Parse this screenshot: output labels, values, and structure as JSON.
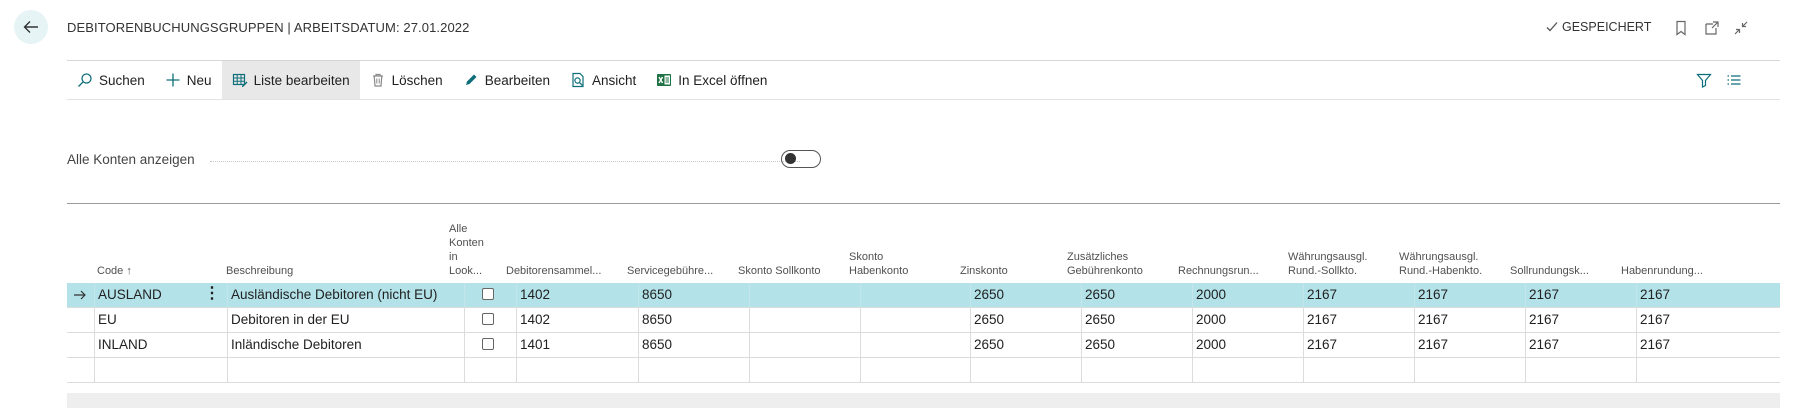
{
  "header": {
    "title": "DEBITORENBUCHUNGSGRUPPEN | ARBEITSDATUM: 27.01.2022",
    "status": "GESPEICHERT"
  },
  "actions": [
    {
      "label": "Suchen",
      "icon": "search-icon"
    },
    {
      "label": "Neu",
      "icon": "plus-icon"
    },
    {
      "label": "Liste bearbeiten",
      "icon": "edit-list-icon"
    },
    {
      "label": "Löschen",
      "icon": "trash-icon"
    },
    {
      "label": "Bearbeiten",
      "icon": "pencil-icon"
    },
    {
      "label": "Ansicht",
      "icon": "view-icon"
    },
    {
      "label": "In Excel öffnen",
      "icon": "excel-icon"
    }
  ],
  "filter": {
    "label": "Alle Konten anzeigen",
    "value": false
  },
  "table": {
    "headers": {
      "code": "Code ↑",
      "beschreibung": "Beschreibung",
      "alle_konten": "Alle Konten in Look...",
      "debitoren": "Debitorensammel...",
      "service": "Servicegebühre...",
      "skonto_soll": "Skonto Sollkonto",
      "skonto_haben": "Skonto Habenkonto",
      "zins": "Zinskonto",
      "zusatz": "Zusätzliches Gebührenkonto",
      "rechnung": "Rechnungsrun...",
      "wa_soll": "Währungsausgl. Rund.-Sollkto.",
      "wa_haben": "Währungsausgl. Rund.-Habenkto.",
      "sollrund": "Sollrundungsk...",
      "habenrund": "Habenrundung..."
    },
    "rows": [
      {
        "code": "AUSLAND",
        "beschreibung": "Ausländische Debitoren (nicht EU)",
        "alle": false,
        "debitoren": "1402",
        "service": "8650",
        "skonto_soll": "",
        "skonto_haben": "",
        "zins": "2650",
        "zusatz": "2650",
        "rechnung": "2000",
        "wa_soll": "2167",
        "wa_haben": "2167",
        "sollrund": "2167",
        "habenrund": "2167"
      },
      {
        "code": "EU",
        "beschreibung": "Debitoren in der EU",
        "alle": false,
        "debitoren": "1402",
        "service": "8650",
        "skonto_soll": "",
        "skonto_haben": "",
        "zins": "2650",
        "zusatz": "2650",
        "rechnung": "2000",
        "wa_soll": "2167",
        "wa_haben": "2167",
        "sollrund": "2167",
        "habenrund": "2167"
      },
      {
        "code": "INLAND",
        "beschreibung": "Inländische Debitoren",
        "alle": false,
        "debitoren": "1401",
        "service": "8650",
        "skonto_soll": "",
        "skonto_haben": "",
        "zins": "2650",
        "zusatz": "2650",
        "rechnung": "2000",
        "wa_soll": "2167",
        "wa_haben": "2167",
        "sollrund": "2167",
        "habenrund": "2167"
      }
    ]
  },
  "colors": {
    "selected_row": "#b3e2e8",
    "back_button": "#e6f4f6",
    "excel_green": "#1e7145"
  }
}
